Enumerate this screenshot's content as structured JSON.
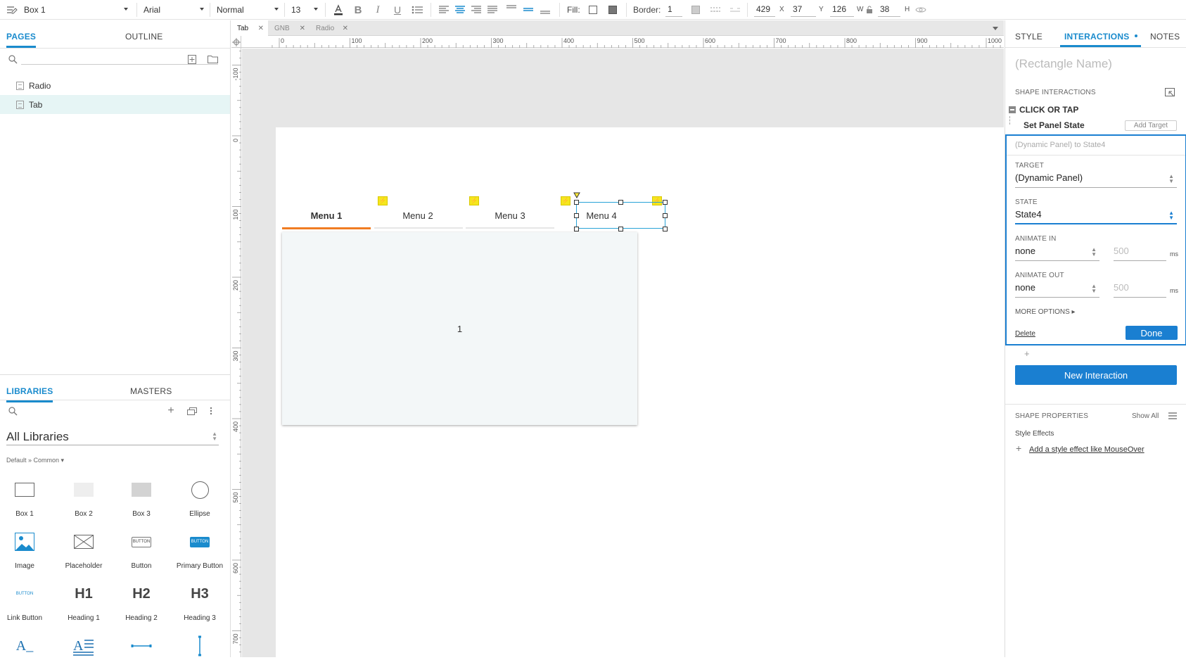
{
  "toolbar": {
    "element_name": "Box 1",
    "font": "Arial",
    "style": "Normal",
    "size": "13",
    "fill_label": "Fill:",
    "border_label": "Border:",
    "border_value": "1",
    "x_value": "429",
    "x_label": "X",
    "y_value": "37",
    "y_label": "Y",
    "w_value": "126",
    "w_label": "W",
    "h_value": "38",
    "h_label": "H"
  },
  "left": {
    "tabs": [
      "PAGES",
      "OUTLINE"
    ],
    "pages": [
      "Radio",
      "Tab"
    ],
    "selected_page": "Tab",
    "lib_tabs": [
      "LIBRARIES",
      "MASTERS"
    ],
    "library_select": "All Libraries",
    "library_path": "Default » Common ▾",
    "widgets": [
      {
        "label": "Box 1"
      },
      {
        "label": "Box 2"
      },
      {
        "label": "Box 3"
      },
      {
        "label": "Ellipse"
      },
      {
        "label": "Image"
      },
      {
        "label": "Placeholder"
      },
      {
        "label": "Button",
        "thumb": "BUTTON"
      },
      {
        "label": "Primary Button",
        "thumb": "BUTTON"
      },
      {
        "label": "Link Button",
        "thumb": "BUTTON"
      },
      {
        "label": "Heading 1",
        "thumb": "H1"
      },
      {
        "label": "Heading 2",
        "thumb": "H2"
      },
      {
        "label": "Heading 3",
        "thumb": "H3"
      }
    ]
  },
  "doc_tabs": [
    "Tab",
    "GNB",
    "Radio"
  ],
  "ruler": {
    "top": [
      "0",
      "100",
      "200",
      "300",
      "400",
      "500",
      "600",
      "700",
      "800",
      "900",
      "1000"
    ],
    "left": [
      "-100",
      "0",
      "100",
      "200",
      "300",
      "400",
      "500",
      "600",
      "700"
    ]
  },
  "canvas": {
    "menus": [
      "Menu 1",
      "Menu 2",
      "Menu 3",
      "Menu 4"
    ],
    "active_menu": "Menu 1",
    "selected_menu": "Menu 4",
    "panel_text": "1",
    "accent": "#f07c22",
    "selection_color": "#29a3d8"
  },
  "right": {
    "tabs": [
      "STYLE",
      "INTERACTIONS",
      "NOTES"
    ],
    "active_tab": "INTERACTIONS",
    "name_placeholder": "(Rectangle Name)",
    "shape_interactions": "SHAPE INTERACTIONS",
    "event": "CLICK OR TAP",
    "action": "Set Panel State",
    "add_target": "Add Target",
    "summary": "(Dynamic Panel) to State4",
    "target_label": "TARGET",
    "target_value": "(Dynamic Panel)",
    "state_label": "STATE",
    "state_value": "State4",
    "animate_in_label": "ANIMATE IN",
    "animate_in_value": "none",
    "animate_in_ms": "500",
    "animate_out_label": "ANIMATE OUT",
    "animate_out_value": "none",
    "animate_out_ms": "500",
    "ms": "ms",
    "more_options": "MORE OPTIONS ▸",
    "delete": "Delete",
    "done": "Done",
    "new_interaction": "New Interaction",
    "shape_properties": "SHAPE PROPERTIES",
    "show_all": "Show All",
    "style_effects": "Style Effects",
    "add_style_effect": "Add a style effect like MouseOver",
    "brand_color": "#1a7fd1"
  }
}
